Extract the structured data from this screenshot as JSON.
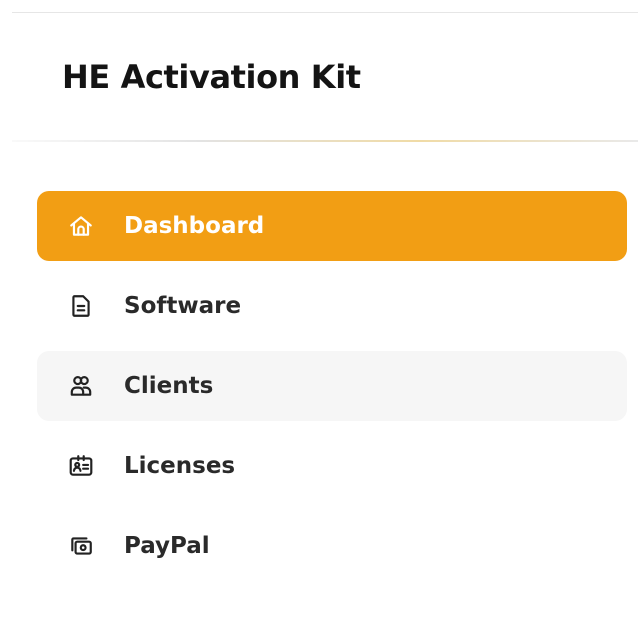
{
  "app": {
    "title": "HE Activation Kit"
  },
  "colors": {
    "accent": "#f29e14",
    "hover_bg": "#f6f6f6",
    "text": "#2a2a2a"
  },
  "sidebar": {
    "items": [
      {
        "label": "Dashboard",
        "icon": "home-icon",
        "state": "active"
      },
      {
        "label": "Software",
        "icon": "document-icon",
        "state": "normal"
      },
      {
        "label": "Clients",
        "icon": "users-icon",
        "state": "hover"
      },
      {
        "label": "Licenses",
        "icon": "id-card-icon",
        "state": "normal"
      },
      {
        "label": "PayPal",
        "icon": "cash-icon",
        "state": "normal"
      }
    ]
  }
}
